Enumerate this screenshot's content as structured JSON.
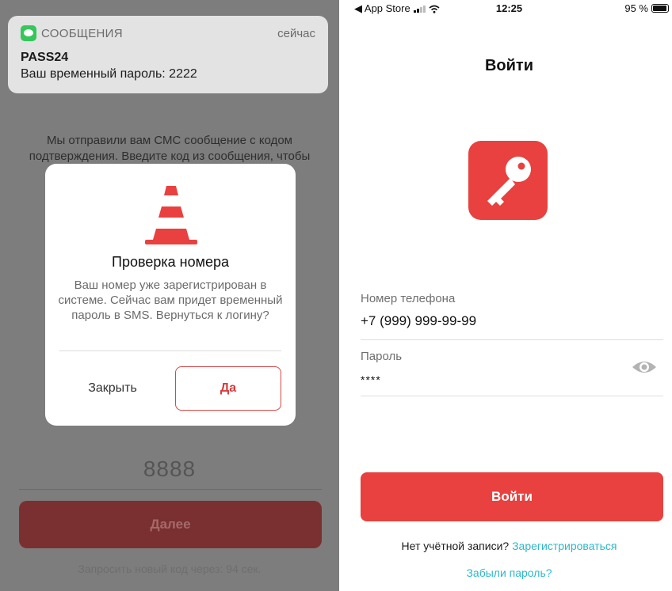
{
  "left_screen": {
    "notification": {
      "app_name": "СООБЩЕНИЯ",
      "time": "сейчас",
      "title": "PASS24",
      "body": "Ваш временный пароль: 2222"
    },
    "background": {
      "message_line1": "Мы отправили вам СМС сообщение с кодом",
      "message_line2": "подтверждения. Введите код из сообщения, чтобы",
      "code_value": "8888",
      "next_button": "Далее",
      "resend_text": "Запросить новый код через: 94 сек.",
      "next_button_color": "#7a3030"
    },
    "dialog": {
      "icon": "traffic-cone-icon",
      "title": "Проверка номера",
      "text": "Ваш номер уже зарегистрирован в системе. Сейчас вам придет временный пароль в SMS. Вернуться к логину?",
      "close_button": "Закрыть",
      "confirm_button": "Да",
      "accent_color": "#d84646"
    }
  },
  "right_screen": {
    "status_bar": {
      "back_app": "◀ App Store",
      "time": "12:25",
      "battery": "95 %"
    },
    "title": "Войти",
    "logo_icon": "key-icon",
    "brand_color": "#e8413f",
    "phone": {
      "label": "Номер телефона",
      "value": "+7 (999) 999-99-99"
    },
    "password": {
      "label": "Пароль",
      "value": "****",
      "toggle_icon": "eye-icon"
    },
    "login_button": "Войти",
    "no_account_text": "Нет учётной записи?",
    "register_link": "Зарегистрироваться",
    "forgot_link": "Забыли пароль?",
    "link_color": "#2fb7c8"
  }
}
